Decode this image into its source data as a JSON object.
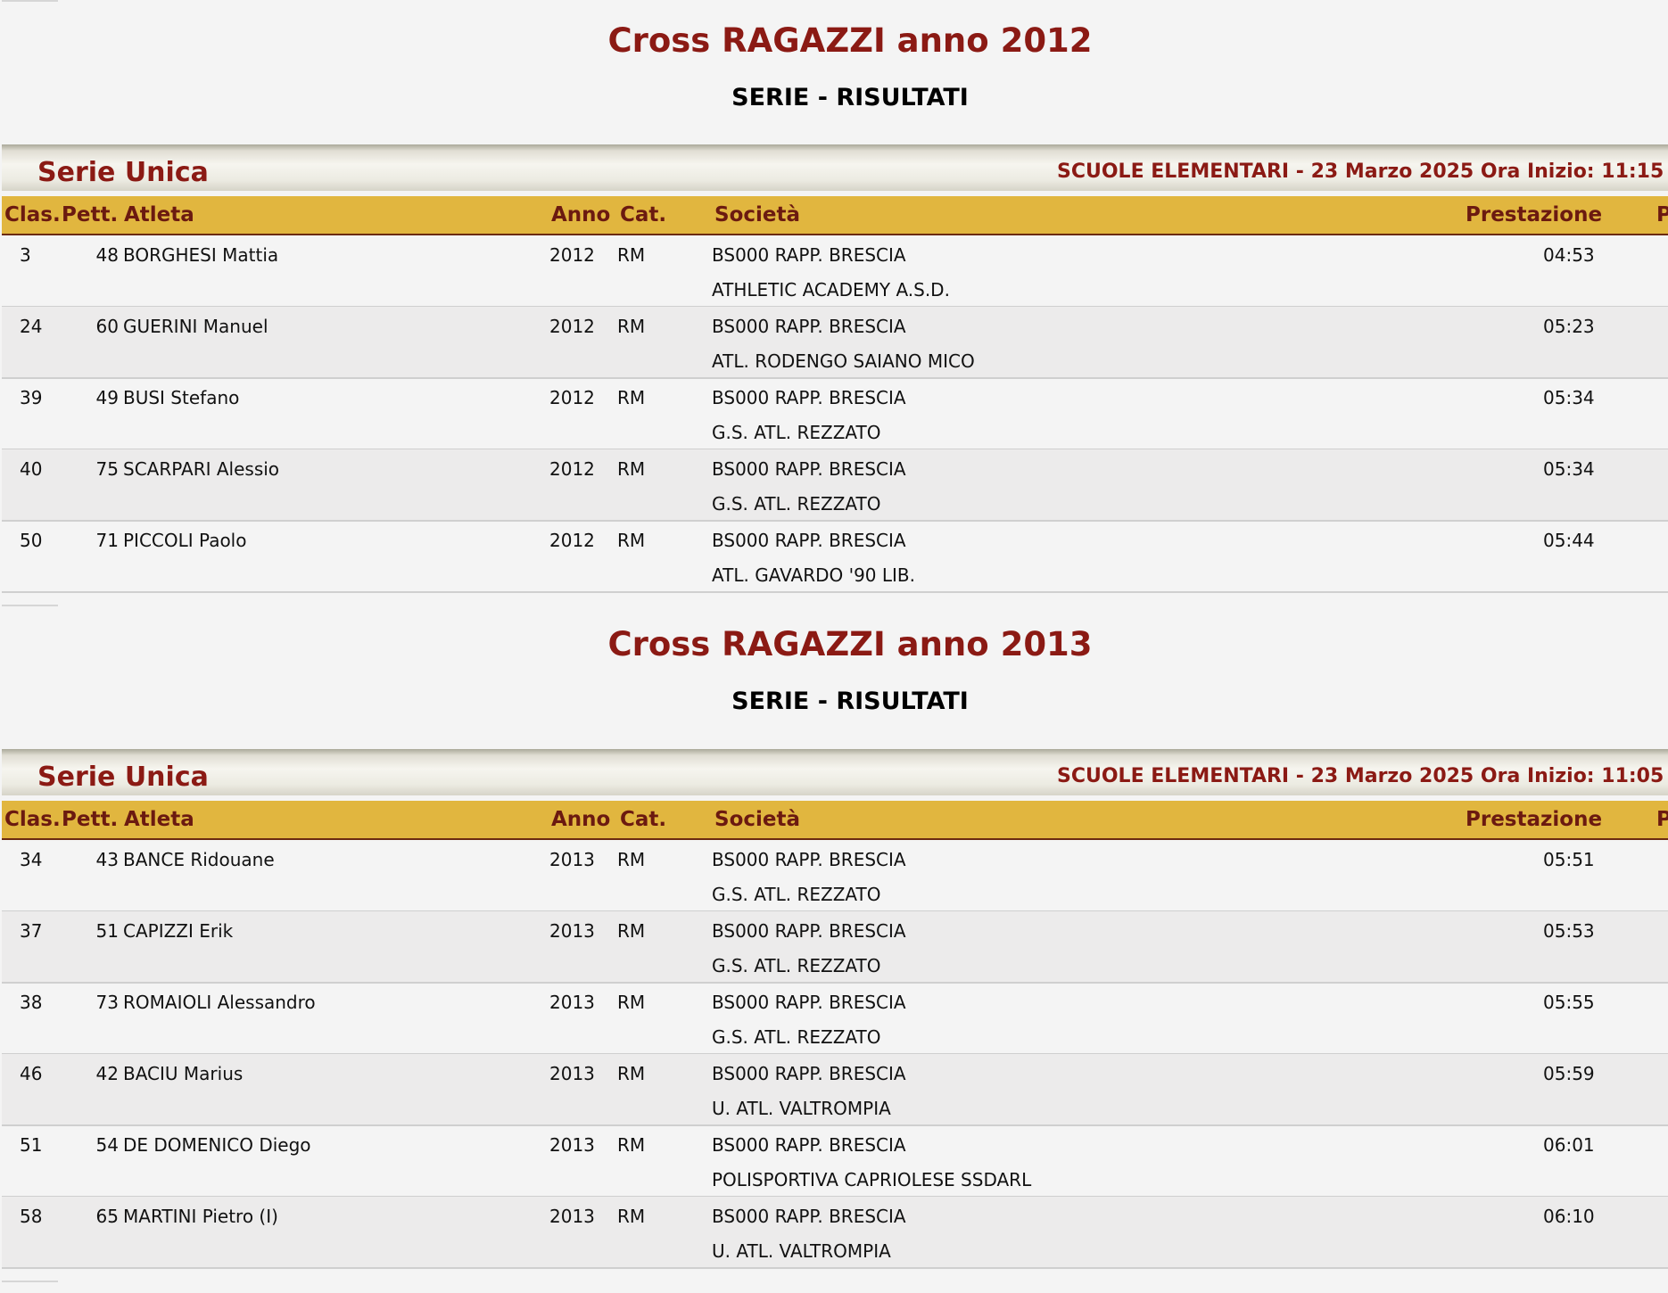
{
  "columns": {
    "clas": "Clas.",
    "pett": "Pett.",
    "atleta": "Atleta",
    "anno": "Anno",
    "cat": "Cat.",
    "societa": "Società",
    "prestazione": "Prestazione",
    "punti_partial": "P"
  },
  "sections": [
    {
      "title": "Cross RAGAZZI anno 2012",
      "phase": "SERIE - RISULTATI",
      "serie_name": "Serie Unica",
      "serie_info": "SCUOLE ELEMENTARI - 23 Marzo 2025 Ora Inizio: 11:15",
      "rows": [
        {
          "clas": "3",
          "pett": "48",
          "atleta": "BORGHESI Mattia",
          "anno": "2012",
          "cat": "RM",
          "societa": "BS000 RAPP. BRESCIA",
          "club": "ATHLETIC ACADEMY A.S.D.",
          "prestazione": "04:53"
        },
        {
          "clas": "24",
          "pett": "60",
          "atleta": "GUERINI Manuel",
          "anno": "2012",
          "cat": "RM",
          "societa": "BS000 RAPP. BRESCIA",
          "club": "ATL. RODENGO SAIANO MICO",
          "prestazione": "05:23"
        },
        {
          "clas": "39",
          "pett": "49",
          "atleta": "BUSI Stefano",
          "anno": "2012",
          "cat": "RM",
          "societa": "BS000 RAPP. BRESCIA",
          "club": "G.S. ATL. REZZATO",
          "prestazione": "05:34"
        },
        {
          "clas": "40",
          "pett": "75",
          "atleta": "SCARPARI Alessio",
          "anno": "2012",
          "cat": "RM",
          "societa": "BS000 RAPP. BRESCIA",
          "club": "G.S. ATL. REZZATO",
          "prestazione": "05:34"
        },
        {
          "clas": "50",
          "pett": "71",
          "atleta": "PICCOLI Paolo",
          "anno": "2012",
          "cat": "RM",
          "societa": "BS000 RAPP. BRESCIA",
          "club": "ATL. GAVARDO '90 LIB.",
          "prestazione": "05:44"
        }
      ]
    },
    {
      "title": "Cross RAGAZZI anno 2013",
      "phase": "SERIE - RISULTATI",
      "serie_name": "Serie Unica",
      "serie_info": "SCUOLE ELEMENTARI - 23 Marzo 2025 Ora Inizio: 11:05",
      "rows": [
        {
          "clas": "34",
          "pett": "43",
          "atleta": "BANCE Ridouane",
          "anno": "2013",
          "cat": "RM",
          "societa": "BS000 RAPP. BRESCIA",
          "club": "G.S. ATL. REZZATO",
          "prestazione": "05:51"
        },
        {
          "clas": "37",
          "pett": "51",
          "atleta": "CAPIZZI Erik",
          "anno": "2013",
          "cat": "RM",
          "societa": "BS000 RAPP. BRESCIA",
          "club": "G.S. ATL. REZZATO",
          "prestazione": "05:53"
        },
        {
          "clas": "38",
          "pett": "73",
          "atleta": "ROMAIOLI Alessandro",
          "anno": "2013",
          "cat": "RM",
          "societa": "BS000 RAPP. BRESCIA",
          "club": "G.S. ATL. REZZATO",
          "prestazione": "05:55"
        },
        {
          "clas": "46",
          "pett": "42",
          "atleta": "BACIU Marius",
          "anno": "2013",
          "cat": "RM",
          "societa": "BS000 RAPP. BRESCIA",
          "club": "U. ATL. VALTROMPIA",
          "prestazione": "05:59"
        },
        {
          "clas": "51",
          "pett": "54",
          "atleta": "DE DOMENICO Diego",
          "anno": "2013",
          "cat": "RM",
          "societa": "BS000 RAPP. BRESCIA",
          "club": "POLISPORTIVA CAPRIOLESE SSDARL",
          "prestazione": "06:01"
        },
        {
          "clas": "58",
          "pett": "65",
          "atleta": "MARTINI Pietro (I)",
          "anno": "2013",
          "cat": "RM",
          "societa": "BS000 RAPP. BRESCIA",
          "club": "U. ATL. VALTROMPIA",
          "prestazione": "06:10"
        }
      ]
    }
  ]
}
